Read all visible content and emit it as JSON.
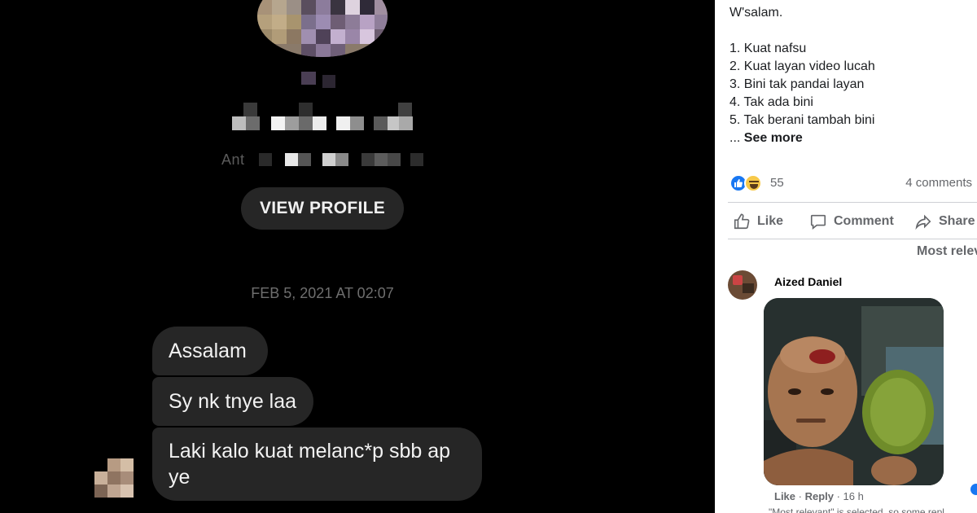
{
  "chat": {
    "partial_subtitle": "Ant",
    "view_profile_label": "VIEW PROFILE",
    "timestamp": "FEB 5, 2021 AT 02:07",
    "messages": [
      "Assalam",
      "Sy nk tnye laa",
      "Laki kalo kuat melanc*p sbb ap ye"
    ]
  },
  "post": {
    "text_lines": [
      "W'salam.",
      "",
      "1. Kuat nafsu",
      "2. Kuat layan video lucah",
      "3. Bini tak pandai layan",
      "4. Tak ada bini",
      "5. Tak berani tambah bini"
    ],
    "see_more_prefix": "... ",
    "see_more": "See more",
    "reaction_count": "55",
    "comments_count": "4 comments",
    "actions": {
      "like": "Like",
      "comment": "Comment",
      "share": "Share"
    },
    "sort_label": "Most relev"
  },
  "comment": {
    "author": "Aized Daniel",
    "like": "Like",
    "reply": "Reply",
    "sep": " · ",
    "time": "16 h",
    "note": "\"Most relevant\" is selected, so some repl"
  },
  "colors": {
    "chat_bg": "#000000",
    "bubble_bg": "#262626",
    "fb_blue": "#1877f2",
    "fb_gray_text": "#65676b"
  },
  "icons": [
    "like-reaction-icon",
    "haha-reaction-icon",
    "thumbs-up-icon",
    "comment-icon",
    "share-icon"
  ]
}
